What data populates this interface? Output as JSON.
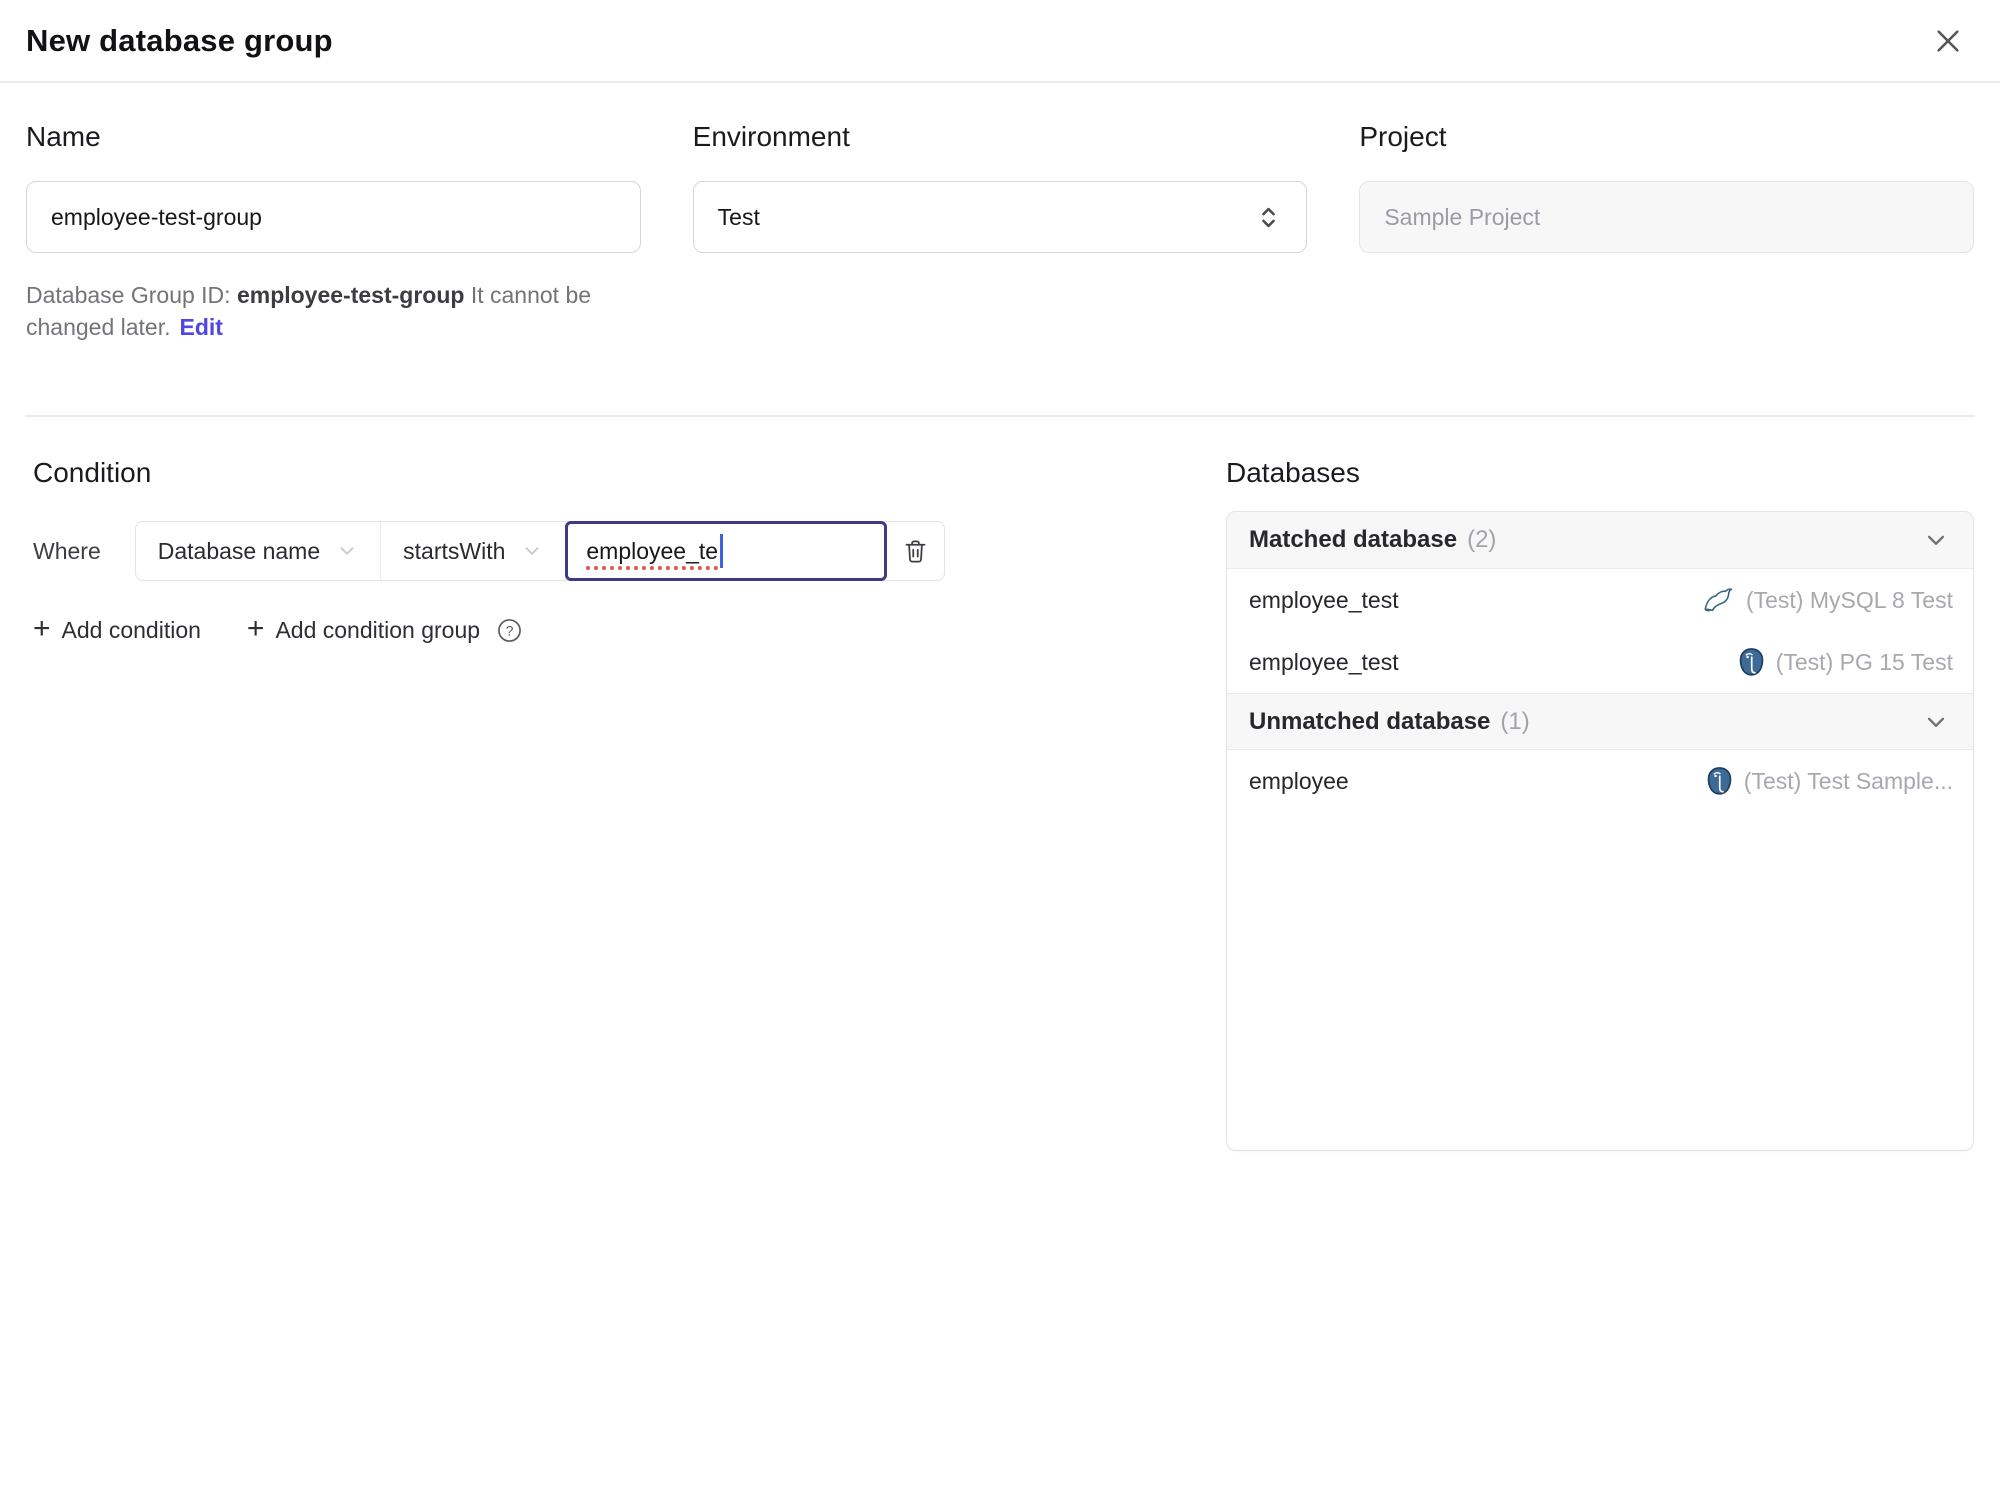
{
  "dialog": {
    "title": "New database group"
  },
  "form": {
    "name": {
      "label": "Name",
      "value": "employee-test-group"
    },
    "environment": {
      "label": "Environment",
      "value": "Test"
    },
    "project": {
      "label": "Project",
      "value": "Sample Project"
    },
    "id_note": {
      "prefix": "Database Group ID: ",
      "id": "employee-test-group",
      "suffix": " It cannot be changed later.",
      "edit_label": "Edit"
    }
  },
  "condition": {
    "heading": "Condition",
    "where_label": "Where",
    "field": "Database name",
    "operator": "startsWith",
    "value": "employee_te",
    "add_condition_label": "Add condition",
    "add_condition_group_label": "Add condition group"
  },
  "databases": {
    "heading": "Databases",
    "sections": [
      {
        "title": "Matched database",
        "count": "(2)",
        "rows": [
          {
            "name": "employee_test",
            "instance": "(Test) MySQL 8 Test",
            "engine": "mysql"
          },
          {
            "name": "employee_test",
            "instance": "(Test) PG 15 Test",
            "engine": "postgres"
          }
        ]
      },
      {
        "title": "Unmatched database",
        "count": "(1)",
        "rows": [
          {
            "name": "employee",
            "instance": "(Test) Test Sample...",
            "engine": "postgres"
          }
        ]
      }
    ]
  },
  "icons": {
    "close": "x-icon",
    "select": "up-down-chevron-icon",
    "dropdown": "chevron-down-icon",
    "delete": "trash-icon",
    "help": "question-circle-icon",
    "mysql": "mysql-dolphin-icon",
    "postgres": "postgres-elephant-icon"
  },
  "colors": {
    "accent": "#4f46e5",
    "focus_border": "#3e3a85",
    "caret": "#3f63e0",
    "spellcheck_underline": "#e2574d",
    "mysql_icon": "#33647f",
    "postgres_icon": "#3d6a96",
    "section_header_bg": "#f7f7f8",
    "border": "#e4e4e7"
  }
}
